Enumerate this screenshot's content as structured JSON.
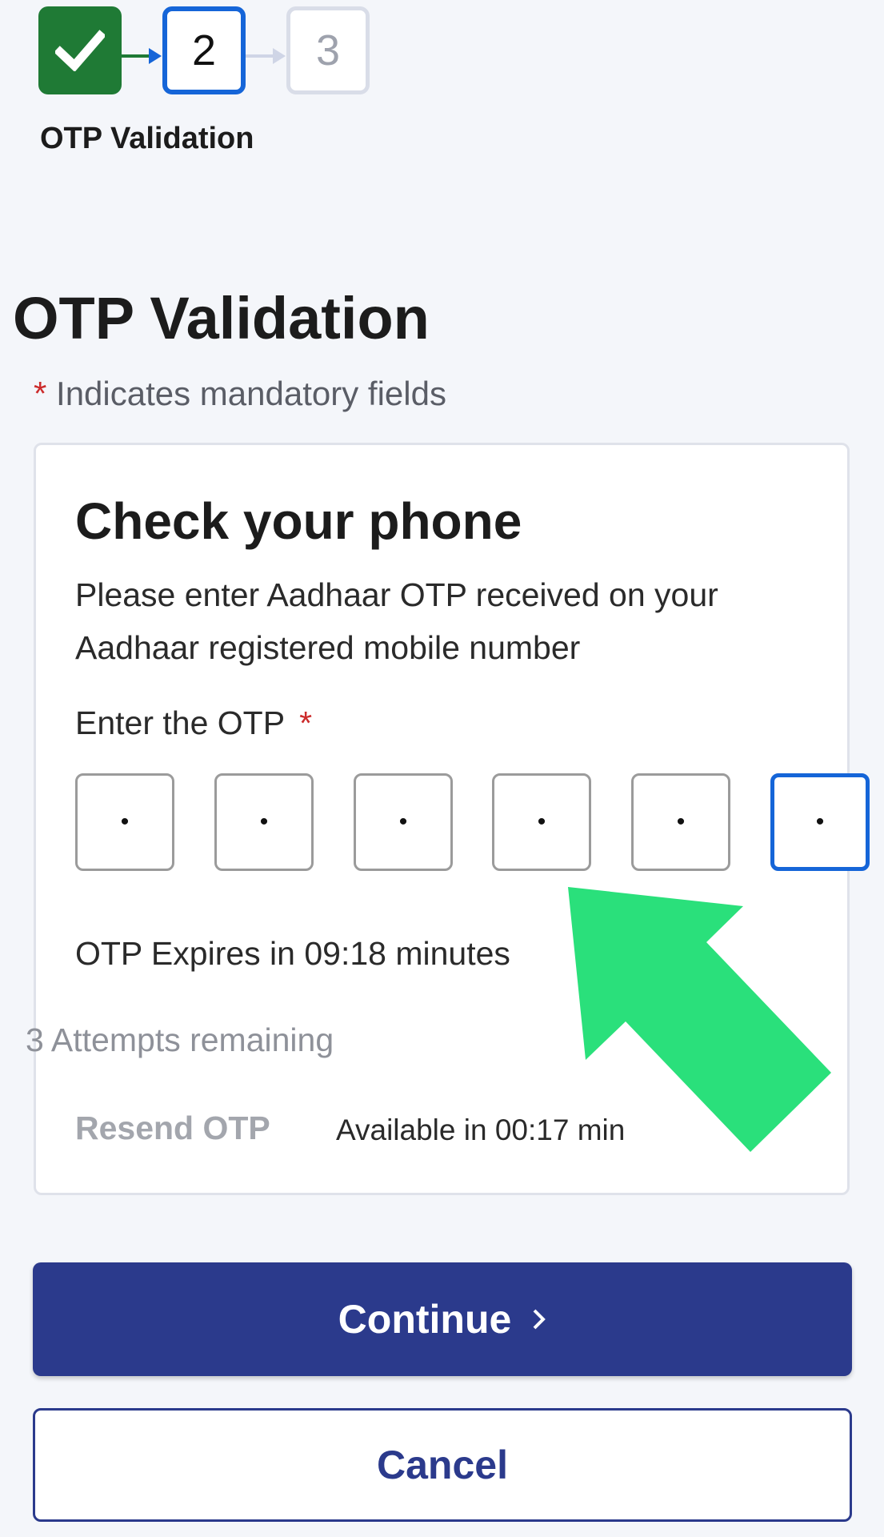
{
  "stepper": {
    "steps": [
      {
        "state": "done",
        "label": ""
      },
      {
        "state": "current",
        "label": "2"
      },
      {
        "state": "todo",
        "label": "3"
      }
    ],
    "current_label": "OTP Validation"
  },
  "page": {
    "title": "OTP Validation",
    "mandatory_note": "Indicates mandatory fields",
    "required_marker": "*"
  },
  "card": {
    "title": "Check your phone",
    "description": "Please enter Aadhaar OTP received on your Aadhaar registered mobile number",
    "otp_label": "Enter the OTP",
    "otp_digits": [
      "•",
      "•",
      "•",
      "•",
      "•",
      "•"
    ],
    "expires_text": "OTP Expires in 09:18 minutes",
    "attempts_text": "3 Attempts remaining",
    "resend_label": "Resend OTP",
    "available_text": "Available in 00:17 min"
  },
  "actions": {
    "continue_label": "Continue",
    "cancel_label": "Cancel"
  },
  "colors": {
    "step_done": "#1f7a35",
    "step_current": "#1565d8",
    "primary": "#2b3a8c",
    "required": "#cc2b2b",
    "overlay_arrow": "#2ae07b"
  },
  "icons": {
    "step_done": "check-icon",
    "continue": "chevron-right-icon",
    "overlay": "pointer-arrow-icon"
  }
}
